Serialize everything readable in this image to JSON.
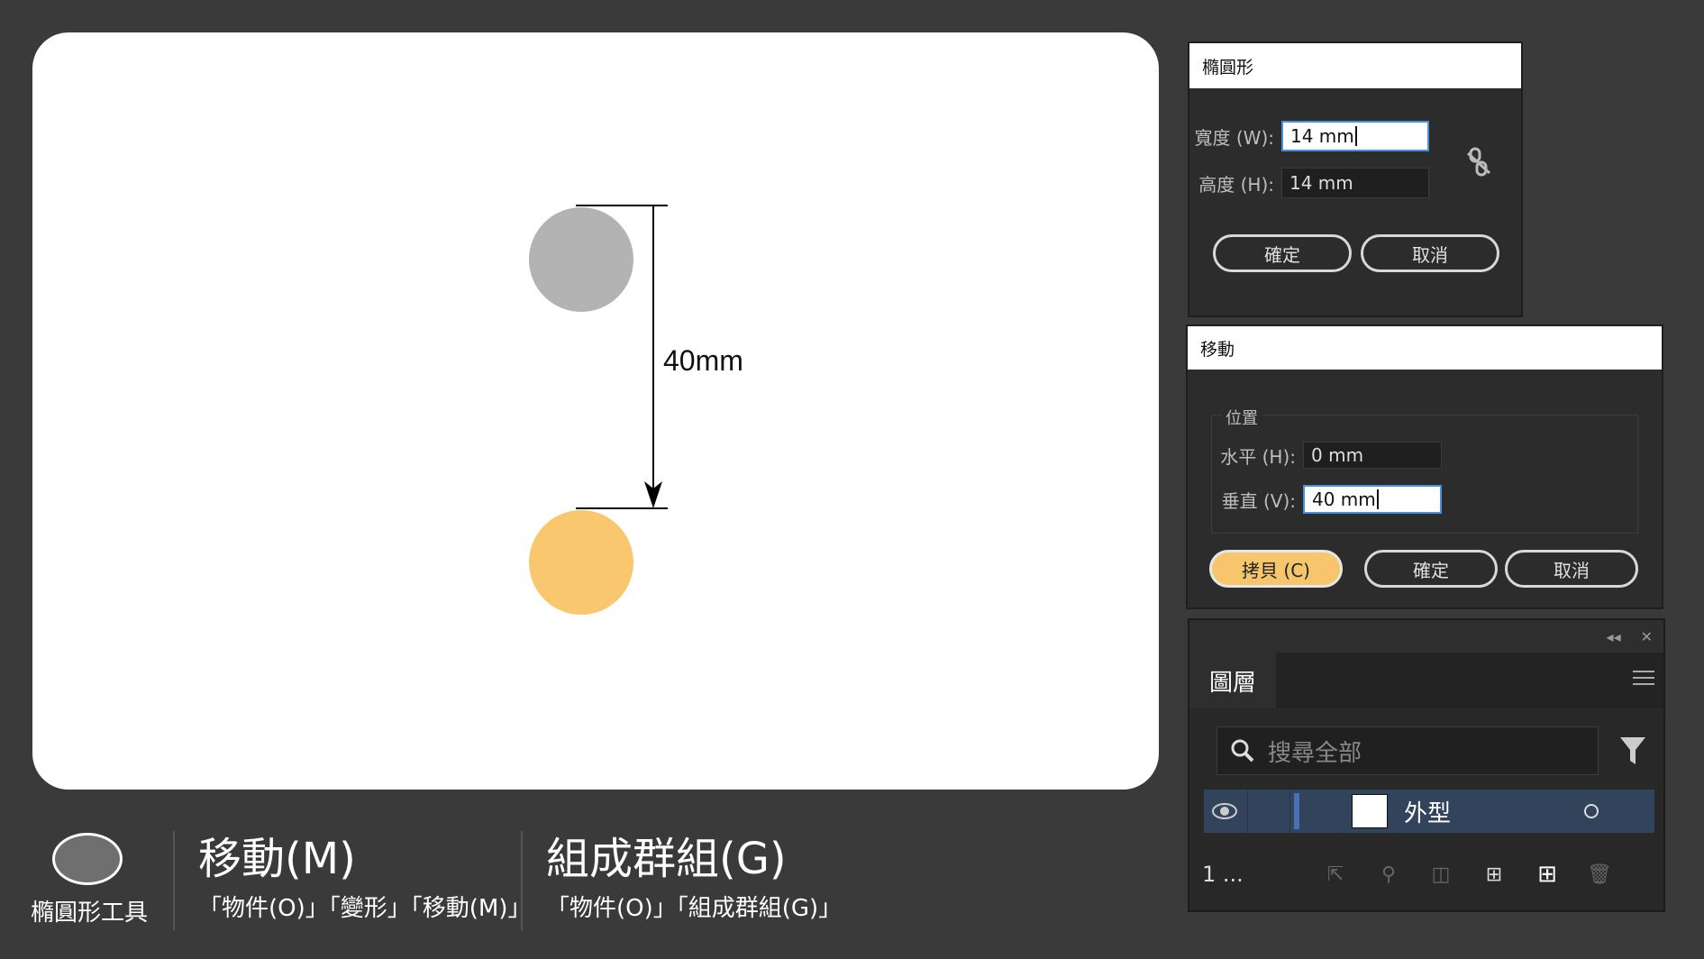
{
  "canvas": {
    "measurement_label": "40mm",
    "colors": {
      "original_circle": "#b3b3b3",
      "copied_circle": "#f9c76e",
      "arrow": "#000000"
    }
  },
  "legend": {
    "tool_label": "橢圓形工具",
    "move": {
      "title": "移動(M)",
      "path": "「物件(O)」「變形」「移動(M)」"
    },
    "group": {
      "title": "組成群組(G)",
      "path": "「物件(O)」「組成群組(G)」"
    }
  },
  "ellipse_dialog": {
    "title": "橢圓形",
    "width_label": "寬度 (W):",
    "width_value": "14 mm",
    "height_label": "高度 (H):",
    "height_value": "14 mm",
    "ok_label": "確定",
    "cancel_label": "取消",
    "link_icon": "unlink-icon"
  },
  "move_dialog": {
    "title": "移動",
    "group_label": "位置",
    "horizontal_label": "水平 (H):",
    "horizontal_value": "0 mm",
    "vertical_label": "垂直 (V):",
    "vertical_value": "40 mm",
    "copy_label": "拷貝 (C)",
    "ok_label": "確定",
    "cancel_label": "取消"
  },
  "layers_panel": {
    "tab_label": "圖層",
    "search_placeholder": "搜尋全部",
    "layer_name": "外型",
    "layer_count": "1 ...",
    "accent": "#4a6fb5",
    "row_color": "#32435c"
  }
}
